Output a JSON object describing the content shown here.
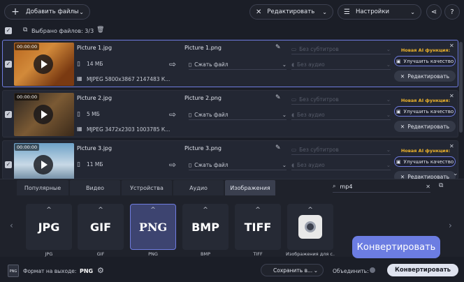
{
  "toolbar": {
    "add_files": "Добавить файлы",
    "edit": "Редактировать",
    "settings": "Настройки"
  },
  "selection": {
    "text": "Выбрано файлов: 3/3"
  },
  "files": [
    {
      "time": "00:00:00",
      "name": "Picture 1.jpg",
      "size": "14 МБ",
      "meta": "MJPEG 5800x3867 2147483 К...",
      "out": "Picture 1.png",
      "compress": "Сжать файл",
      "subs": "Без субтитров",
      "audio": "Без аудио",
      "ai": "Новая AI функция:",
      "improve": "Улучшить качество",
      "edit": "Редактировать"
    },
    {
      "time": "00:00:00",
      "name": "Picture 2.jpg",
      "size": "5 МБ",
      "meta": "MJPEG 3472x2303 1003785 К...",
      "out": "Picture 2.png",
      "compress": "Сжать файл",
      "subs": "Без субтитров",
      "audio": "Без аудио",
      "ai": "Новая AI функция:",
      "improve": "Улучшить качество",
      "edit": "Редактировать"
    },
    {
      "time": "00:00:00",
      "name": "Picture 3.jpg",
      "size": "11 МБ",
      "meta": "",
      "out": "Picture 3.png",
      "compress": "Сжать файл",
      "subs": "Без субтитров",
      "audio": "Без аудио",
      "ai": "Новая AI функция:",
      "improve": "Улучшить качество",
      "edit": "Редактировать"
    }
  ],
  "tabs": [
    "Популярные",
    "Видео",
    "Устройства",
    "Аудио",
    "Изображения"
  ],
  "search": {
    "value": "mp4"
  },
  "formats": [
    {
      "label": "JPG",
      "caption": "JPG"
    },
    {
      "label": "GIF",
      "caption": "GIF"
    },
    {
      "label": "PNG",
      "caption": "PNG"
    },
    {
      "label": "BMP",
      "caption": "BMP"
    },
    {
      "label": "TIFF",
      "caption": "TIFF"
    },
    {
      "label": "",
      "caption": "Изображения для с..."
    }
  ],
  "footer": {
    "format_label": "Формат на выходе:",
    "format_value": "PNG",
    "format_badge": "PNG",
    "save_to": "Сохранить в...",
    "merge": "Объединить:",
    "convert": "Конвертировать",
    "tooltip": "Конвертировать"
  }
}
